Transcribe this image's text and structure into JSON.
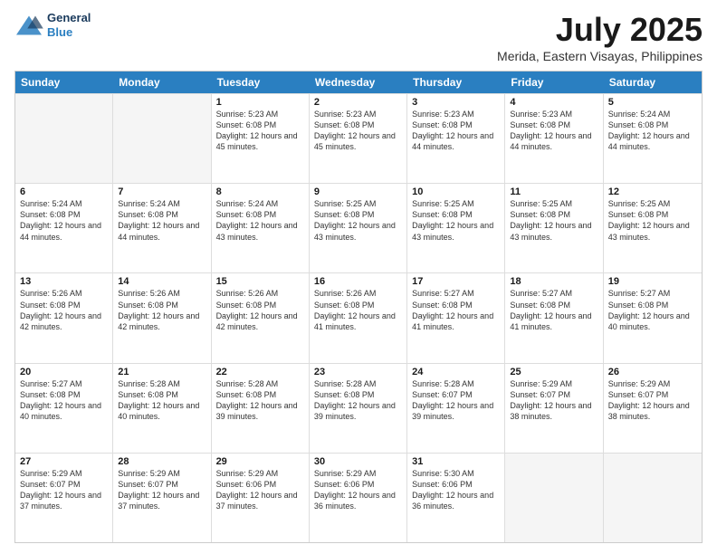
{
  "logo": {
    "line1": "General",
    "line2": "Blue"
  },
  "title": "July 2025",
  "subtitle": "Merida, Eastern Visayas, Philippines",
  "days": [
    "Sunday",
    "Monday",
    "Tuesday",
    "Wednesday",
    "Thursday",
    "Friday",
    "Saturday"
  ],
  "weeks": [
    [
      {
        "day": "",
        "empty": true
      },
      {
        "day": "",
        "empty": true
      },
      {
        "day": "1",
        "rise": "5:23 AM",
        "set": "6:08 PM",
        "daylight": "12 hours and 45 minutes."
      },
      {
        "day": "2",
        "rise": "5:23 AM",
        "set": "6:08 PM",
        "daylight": "12 hours and 45 minutes."
      },
      {
        "day": "3",
        "rise": "5:23 AM",
        "set": "6:08 PM",
        "daylight": "12 hours and 44 minutes."
      },
      {
        "day": "4",
        "rise": "5:23 AM",
        "set": "6:08 PM",
        "daylight": "12 hours and 44 minutes."
      },
      {
        "day": "5",
        "rise": "5:24 AM",
        "set": "6:08 PM",
        "daylight": "12 hours and 44 minutes."
      }
    ],
    [
      {
        "day": "6",
        "rise": "5:24 AM",
        "set": "6:08 PM",
        "daylight": "12 hours and 44 minutes."
      },
      {
        "day": "7",
        "rise": "5:24 AM",
        "set": "6:08 PM",
        "daylight": "12 hours and 44 minutes."
      },
      {
        "day": "8",
        "rise": "5:24 AM",
        "set": "6:08 PM",
        "daylight": "12 hours and 43 minutes."
      },
      {
        "day": "9",
        "rise": "5:25 AM",
        "set": "6:08 PM",
        "daylight": "12 hours and 43 minutes."
      },
      {
        "day": "10",
        "rise": "5:25 AM",
        "set": "6:08 PM",
        "daylight": "12 hours and 43 minutes."
      },
      {
        "day": "11",
        "rise": "5:25 AM",
        "set": "6:08 PM",
        "daylight": "12 hours and 43 minutes."
      },
      {
        "day": "12",
        "rise": "5:25 AM",
        "set": "6:08 PM",
        "daylight": "12 hours and 43 minutes."
      }
    ],
    [
      {
        "day": "13",
        "rise": "5:26 AM",
        "set": "6:08 PM",
        "daylight": "12 hours and 42 minutes."
      },
      {
        "day": "14",
        "rise": "5:26 AM",
        "set": "6:08 PM",
        "daylight": "12 hours and 42 minutes."
      },
      {
        "day": "15",
        "rise": "5:26 AM",
        "set": "6:08 PM",
        "daylight": "12 hours and 42 minutes."
      },
      {
        "day": "16",
        "rise": "5:26 AM",
        "set": "6:08 PM",
        "daylight": "12 hours and 41 minutes."
      },
      {
        "day": "17",
        "rise": "5:27 AM",
        "set": "6:08 PM",
        "daylight": "12 hours and 41 minutes."
      },
      {
        "day": "18",
        "rise": "5:27 AM",
        "set": "6:08 PM",
        "daylight": "12 hours and 41 minutes."
      },
      {
        "day": "19",
        "rise": "5:27 AM",
        "set": "6:08 PM",
        "daylight": "12 hours and 40 minutes."
      }
    ],
    [
      {
        "day": "20",
        "rise": "5:27 AM",
        "set": "6:08 PM",
        "daylight": "12 hours and 40 minutes."
      },
      {
        "day": "21",
        "rise": "5:28 AM",
        "set": "6:08 PM",
        "daylight": "12 hours and 40 minutes."
      },
      {
        "day": "22",
        "rise": "5:28 AM",
        "set": "6:08 PM",
        "daylight": "12 hours and 39 minutes."
      },
      {
        "day": "23",
        "rise": "5:28 AM",
        "set": "6:08 PM",
        "daylight": "12 hours and 39 minutes."
      },
      {
        "day": "24",
        "rise": "5:28 AM",
        "set": "6:07 PM",
        "daylight": "12 hours and 39 minutes."
      },
      {
        "day": "25",
        "rise": "5:29 AM",
        "set": "6:07 PM",
        "daylight": "12 hours and 38 minutes."
      },
      {
        "day": "26",
        "rise": "5:29 AM",
        "set": "6:07 PM",
        "daylight": "12 hours and 38 minutes."
      }
    ],
    [
      {
        "day": "27",
        "rise": "5:29 AM",
        "set": "6:07 PM",
        "daylight": "12 hours and 37 minutes."
      },
      {
        "day": "28",
        "rise": "5:29 AM",
        "set": "6:07 PM",
        "daylight": "12 hours and 37 minutes."
      },
      {
        "day": "29",
        "rise": "5:29 AM",
        "set": "6:06 PM",
        "daylight": "12 hours and 37 minutes."
      },
      {
        "day": "30",
        "rise": "5:29 AM",
        "set": "6:06 PM",
        "daylight": "12 hours and 36 minutes."
      },
      {
        "day": "31",
        "rise": "5:30 AM",
        "set": "6:06 PM",
        "daylight": "12 hours and 36 minutes."
      },
      {
        "day": "",
        "empty": true
      },
      {
        "day": "",
        "empty": true
      }
    ]
  ]
}
